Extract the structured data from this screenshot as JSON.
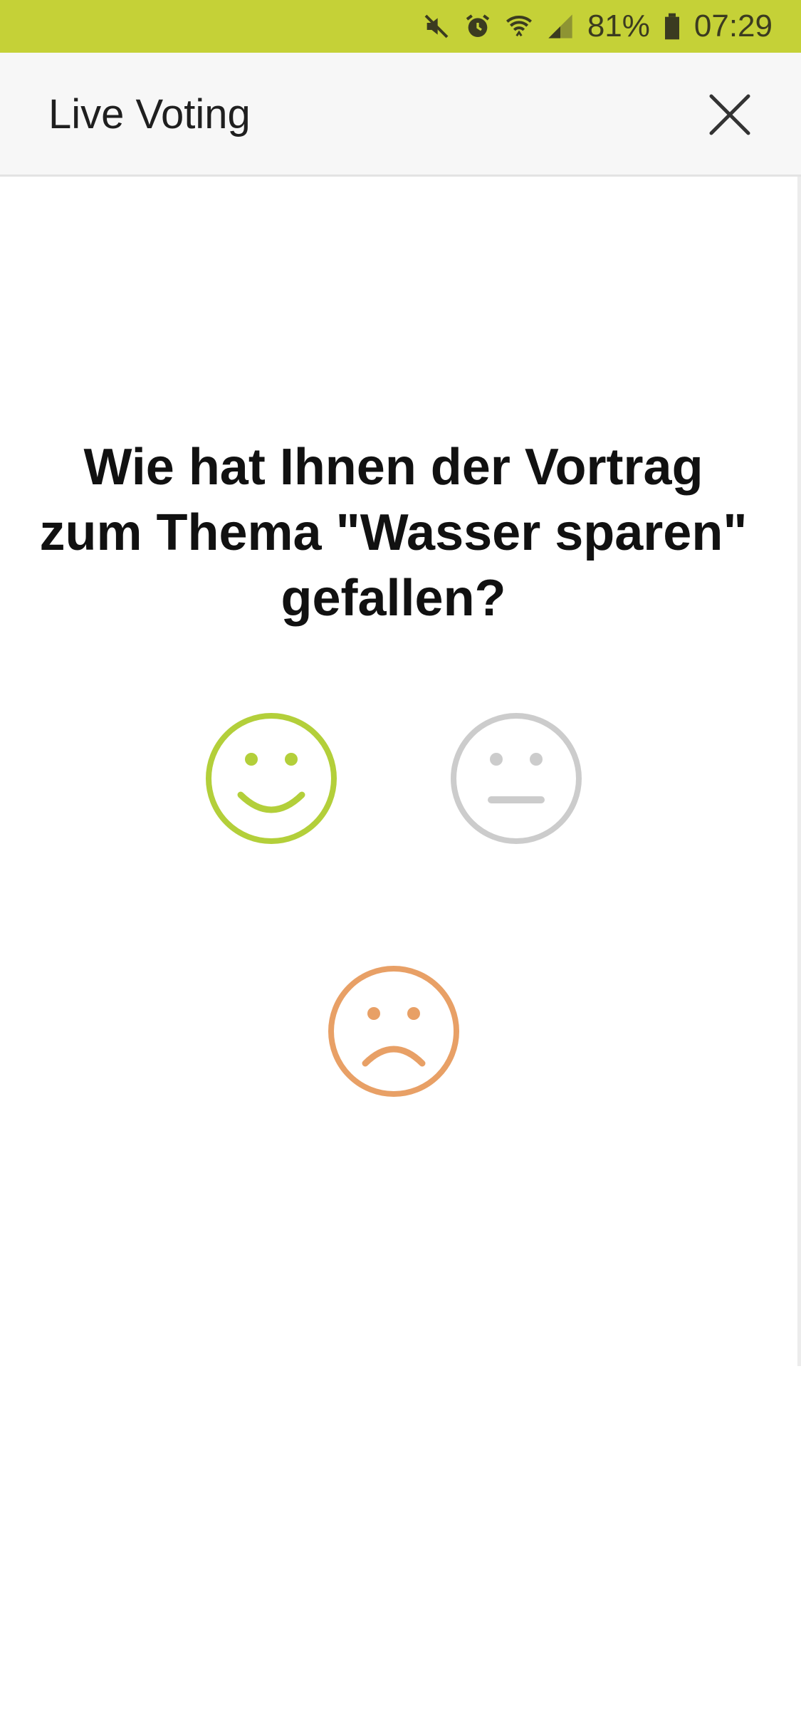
{
  "status_bar": {
    "battery": "81%",
    "time": "07:29",
    "icons": [
      "mute-icon",
      "alarm-icon",
      "wifi-icon",
      "signal-icon",
      "battery-icon"
    ],
    "background_color": "#c5d137"
  },
  "app_bar": {
    "title": "Live Voting",
    "close_icon": "close-icon"
  },
  "question": {
    "text": "Wie hat Ihnen der Vortrag zum Thema \"Wasser sparen\" gefallen?"
  },
  "options": [
    {
      "id": "happy",
      "icon": "happy-face-icon",
      "color": "#b3cf3a"
    },
    {
      "id": "neutral",
      "icon": "neutral-face-icon",
      "color": "#cccccc"
    },
    {
      "id": "sad",
      "icon": "sad-face-icon",
      "color": "#e8a066"
    }
  ]
}
